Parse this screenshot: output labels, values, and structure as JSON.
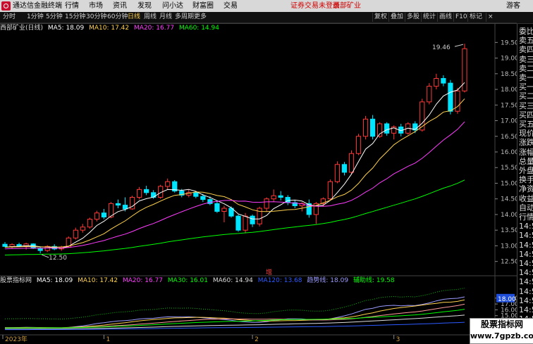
{
  "app": {
    "title": "通达信金融终端",
    "menus": [
      "行情",
      "市场",
      "资讯",
      "发现",
      "问小达",
      "财富圈",
      "交易"
    ],
    "warning": "证券交易未登录",
    "stock_name": "西部矿业",
    "guest": "游客"
  },
  "toolbar": {
    "periods": [
      "分时",
      "1分钟",
      "5分钟",
      "15分钟",
      "30分钟",
      "60分钟",
      "日线",
      "周线",
      "月线",
      "多周期",
      "更多"
    ],
    "active": "日线",
    "right": [
      "复权",
      "叠加",
      "多股",
      "统计",
      "画线",
      "F10",
      "标记"
    ],
    "close": "×"
  },
  "main_info": {
    "name": "西部矿业(日线)",
    "ma5": "MA5: 18.09",
    "ma10": "MA10: 17.42",
    "ma20": "MA20: 16.77",
    "ma60": "MA60: 14.94"
  },
  "sub_info": {
    "name": "股票指标网",
    "ma5": "MA5: 18.09",
    "ma10": "MA10: 17.42",
    "ma20": "MA20: 16.77",
    "ma30": "MA30: 16.01",
    "ma60": "MA60: 14.94",
    "ma120": "MA120: 13.68",
    "trend": "趋势线: 18.09",
    "aux": "辅助线: 19.58"
  },
  "colors": {
    "up": "#ff3838",
    "down": "#00e5ff",
    "ma5": "#ffffff",
    "ma10": "#ffd24d",
    "ma20": "#ff3cff",
    "ma60": "#00ff00",
    "ma120": "#2d5bff",
    "bg": "#000000"
  },
  "price_axis": [
    "19.50",
    "19.00",
    "18.50",
    "18.00",
    "17.50",
    "17.00",
    "16.50",
    "16.00",
    "15.50",
    "15.00",
    "14.50",
    "14.00",
    "13.50",
    "13.00",
    "12.50"
  ],
  "sub_axis": {
    "ticks": [
      "18.00",
      "17.00",
      "16.00",
      "15.00"
    ],
    "tag": "18.00"
  },
  "annotations": {
    "high": "19.46",
    "low": "12.50",
    "vol": "增"
  },
  "date_labels": [
    "2023年",
    "1",
    "2",
    "3"
  ],
  "sidebar": [
    "委比",
    "卖五",
    "卖四",
    "卖三",
    "卖二",
    "卖一",
    "买一",
    "买二",
    "买三",
    "买四",
    "买五",
    "现价",
    "涨跌",
    "涨幅",
    "总量",
    "外盘",
    "换手",
    "净资",
    "收益",
    "自动",
    "行情",
    "14:5",
    "14:5",
    "14:5",
    "14:5",
    "14:5",
    "14:5",
    "14:5",
    "14:5",
    "14:5",
    "14:5",
    "14:5"
  ],
  "watermark": {
    "line1": "股票指标网",
    "line2": "www.7gpzb.com"
  },
  "chart_data": {
    "type": "candlestick",
    "ylim": [
      12.2,
      19.8
    ],
    "candles": [
      {
        "o": 13.05,
        "h": 13.12,
        "l": 12.95,
        "c": 12.98
      },
      {
        "o": 12.98,
        "h": 13.08,
        "l": 12.92,
        "c": 13.04
      },
      {
        "o": 13.04,
        "h": 13.1,
        "l": 12.96,
        "c": 12.99
      },
      {
        "o": 12.99,
        "h": 13.1,
        "l": 12.88,
        "c": 13.06
      },
      {
        "o": 13.06,
        "h": 13.08,
        "l": 12.9,
        "c": 12.92
      },
      {
        "o": 12.92,
        "h": 12.98,
        "l": 12.76,
        "c": 12.85
      },
      {
        "o": 12.85,
        "h": 13.02,
        "l": 12.8,
        "c": 12.98
      },
      {
        "o": 12.98,
        "h": 13.05,
        "l": 12.86,
        "c": 12.9
      },
      {
        "o": 12.9,
        "h": 13.0,
        "l": 12.84,
        "c": 12.96
      },
      {
        "o": 12.96,
        "h": 13.3,
        "l": 12.94,
        "c": 13.25
      },
      {
        "o": 13.25,
        "h": 13.58,
        "l": 13.2,
        "c": 13.5
      },
      {
        "o": 13.5,
        "h": 13.7,
        "l": 13.42,
        "c": 13.6
      },
      {
        "o": 13.6,
        "h": 13.9,
        "l": 13.55,
        "c": 13.85
      },
      {
        "o": 13.85,
        "h": 14.12,
        "l": 13.78,
        "c": 14.05
      },
      {
        "o": 14.05,
        "h": 14.18,
        "l": 13.85,
        "c": 13.92
      },
      {
        "o": 13.92,
        "h": 14.4,
        "l": 13.88,
        "c": 14.35
      },
      {
        "o": 14.35,
        "h": 14.48,
        "l": 14.2,
        "c": 14.3
      },
      {
        "o": 14.3,
        "h": 14.55,
        "l": 14.1,
        "c": 14.18
      },
      {
        "o": 14.18,
        "h": 14.6,
        "l": 14.15,
        "c": 14.55
      },
      {
        "o": 14.55,
        "h": 14.88,
        "l": 14.48,
        "c": 14.8
      },
      {
        "o": 14.8,
        "h": 14.92,
        "l": 14.62,
        "c": 14.7
      },
      {
        "o": 14.7,
        "h": 14.78,
        "l": 14.5,
        "c": 14.55
      },
      {
        "o": 14.55,
        "h": 14.95,
        "l": 14.5,
        "c": 14.9
      },
      {
        "o": 14.9,
        "h": 15.15,
        "l": 14.8,
        "c": 15.05
      },
      {
        "o": 15.05,
        "h": 15.1,
        "l": 14.7,
        "c": 14.75
      },
      {
        "o": 14.75,
        "h": 14.82,
        "l": 14.55,
        "c": 14.62
      },
      {
        "o": 14.62,
        "h": 14.8,
        "l": 14.55,
        "c": 14.7
      },
      {
        "o": 14.7,
        "h": 14.75,
        "l": 14.52,
        "c": 14.58
      },
      {
        "o": 14.58,
        "h": 14.66,
        "l": 14.4,
        "c": 14.48
      },
      {
        "o": 14.48,
        "h": 14.58,
        "l": 14.3,
        "c": 14.35
      },
      {
        "o": 14.35,
        "h": 14.45,
        "l": 14.05,
        "c": 14.1
      },
      {
        "o": 14.1,
        "h": 14.28,
        "l": 13.75,
        "c": 14.2
      },
      {
        "o": 14.2,
        "h": 14.26,
        "l": 13.9,
        "c": 13.95
      },
      {
        "o": 13.95,
        "h": 14.0,
        "l": 13.45,
        "c": 13.5
      },
      {
        "o": 13.5,
        "h": 14.05,
        "l": 13.4,
        "c": 13.95
      },
      {
        "o": 13.95,
        "h": 14.0,
        "l": 13.6,
        "c": 13.7
      },
      {
        "o": 13.7,
        "h": 14.25,
        "l": 13.62,
        "c": 14.2
      },
      {
        "o": 14.2,
        "h": 14.55,
        "l": 14.1,
        "c": 14.5
      },
      {
        "o": 14.5,
        "h": 14.8,
        "l": 14.4,
        "c": 14.6
      },
      {
        "o": 14.6,
        "h": 14.75,
        "l": 14.45,
        "c": 14.55
      },
      {
        "o": 14.55,
        "h": 14.62,
        "l": 14.3,
        "c": 14.38
      },
      {
        "o": 14.38,
        "h": 14.45,
        "l": 14.2,
        "c": 14.28
      },
      {
        "o": 14.28,
        "h": 14.4,
        "l": 14.1,
        "c": 14.35
      },
      {
        "o": 14.35,
        "h": 14.48,
        "l": 13.9,
        "c": 14.0
      },
      {
        "o": 14.0,
        "h": 14.4,
        "l": 13.7,
        "c": 14.35
      },
      {
        "o": 14.35,
        "h": 14.55,
        "l": 14.25,
        "c": 14.5
      },
      {
        "o": 14.5,
        "h": 15.12,
        "l": 14.45,
        "c": 15.05
      },
      {
        "o": 15.05,
        "h": 15.7,
        "l": 15.0,
        "c": 15.6
      },
      {
        "o": 15.6,
        "h": 15.68,
        "l": 15.25,
        "c": 15.35
      },
      {
        "o": 15.35,
        "h": 16.05,
        "l": 15.3,
        "c": 15.95
      },
      {
        "o": 15.95,
        "h": 16.58,
        "l": 15.9,
        "c": 16.5
      },
      {
        "o": 16.5,
        "h": 17.15,
        "l": 16.4,
        "c": 17.05
      },
      {
        "o": 17.05,
        "h": 17.18,
        "l": 16.4,
        "c": 16.5
      },
      {
        "o": 16.5,
        "h": 16.95,
        "l": 16.45,
        "c": 16.9
      },
      {
        "o": 16.9,
        "h": 16.95,
        "l": 16.52,
        "c": 16.6
      },
      {
        "o": 16.6,
        "h": 16.85,
        "l": 16.4,
        "c": 16.8
      },
      {
        "o": 16.8,
        "h": 16.9,
        "l": 16.5,
        "c": 16.6
      },
      {
        "o": 16.6,
        "h": 16.95,
        "l": 16.55,
        "c": 16.9
      },
      {
        "o": 16.9,
        "h": 16.98,
        "l": 16.6,
        "c": 16.7
      },
      {
        "o": 16.7,
        "h": 17.7,
        "l": 16.65,
        "c": 17.6
      },
      {
        "o": 17.6,
        "h": 18.2,
        "l": 17.52,
        "c": 18.1
      },
      {
        "o": 18.1,
        "h": 18.5,
        "l": 18.0,
        "c": 18.35
      },
      {
        "o": 18.35,
        "h": 18.45,
        "l": 18.1,
        "c": 18.2
      },
      {
        "o": 18.2,
        "h": 18.3,
        "l": 17.2,
        "c": 17.3
      },
      {
        "o": 17.3,
        "h": 18.05,
        "l": 17.22,
        "c": 17.95
      },
      {
        "o": 17.95,
        "h": 19.46,
        "l": 17.9,
        "c": 19.3
      }
    ]
  }
}
